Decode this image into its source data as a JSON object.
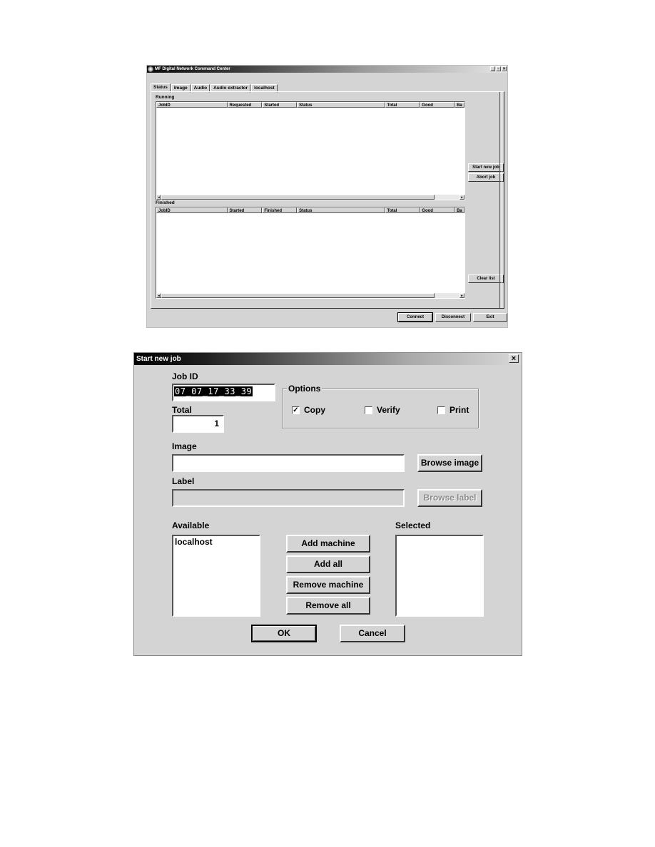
{
  "main_window": {
    "title": "MF Digital Network Command Center",
    "controls": {
      "minimize": "_",
      "maximize": "▫",
      "close": "×"
    },
    "tabs": [
      {
        "label": "Status",
        "active": true
      },
      {
        "label": "Image",
        "active": false
      },
      {
        "label": "Audio",
        "active": false
      },
      {
        "label": "Audio extractor",
        "active": false
      },
      {
        "label": "localhost",
        "active": false
      }
    ],
    "running": {
      "label": "Running",
      "columns": [
        "JobID",
        "Requested",
        "Started",
        "Status",
        "Total",
        "Good",
        "Ba"
      ],
      "rows": []
    },
    "finished": {
      "label": "Finished",
      "columns": [
        "JobID",
        "Started",
        "Finished",
        "Status",
        "Total",
        "Good",
        "Ba"
      ],
      "rows": []
    },
    "buttons": {
      "start_new_job": "Start new job",
      "abort_job": "Abort job",
      "clear_list": "Clear list",
      "connect": "Connect",
      "disconnect": "Disconnect",
      "exit": "Exit"
    },
    "scroll": {
      "left": "◂",
      "right": "▸"
    }
  },
  "dialog": {
    "title": "Start new job",
    "close": "×",
    "job_id": {
      "label": "Job ID",
      "value": "07_07_17_33_39"
    },
    "total": {
      "label": "Total",
      "value": "1"
    },
    "options": {
      "label": "Options",
      "items": [
        {
          "label": "Copy",
          "checked": true,
          "mark": "✓"
        },
        {
          "label": "Verify",
          "checked": false,
          "mark": ""
        },
        {
          "label": "Print",
          "checked": false,
          "mark": ""
        }
      ]
    },
    "image": {
      "label": "Image",
      "value": "",
      "button": "Browse image"
    },
    "label_field": {
      "label": "Label",
      "value": "",
      "button": "Browse label",
      "disabled": true
    },
    "available": {
      "label": "Available",
      "items": [
        "localhost"
      ]
    },
    "selected": {
      "label": "Selected",
      "items": []
    },
    "buttons": {
      "add_machine": "Add machine",
      "add_all": "Add all",
      "remove_machine": "Remove machine",
      "remove_all": "Remove all",
      "ok": "OK",
      "cancel": "Cancel"
    }
  }
}
